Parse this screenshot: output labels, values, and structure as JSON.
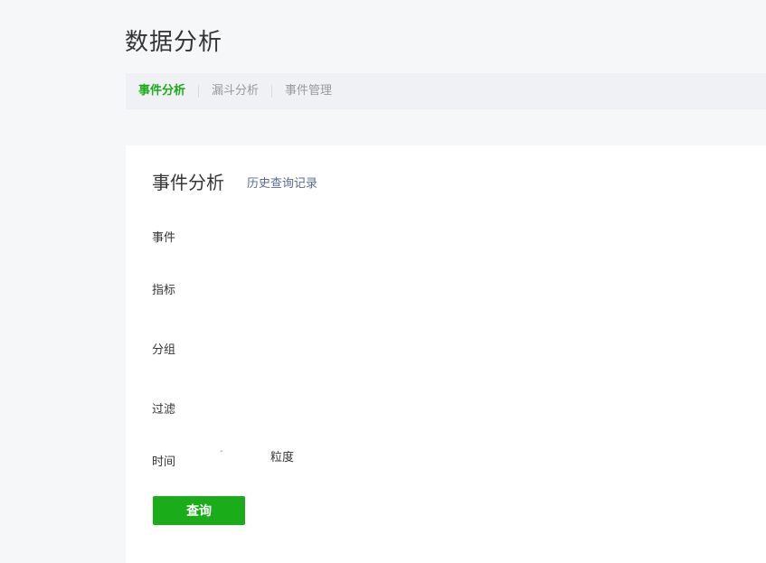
{
  "page": {
    "title": "数据分析"
  },
  "tabs": [
    {
      "label": "事件分析",
      "active": true
    },
    {
      "label": "漏斗分析",
      "active": false
    },
    {
      "label": "事件管理",
      "active": false
    }
  ],
  "card": {
    "title": "事件分析",
    "history_link": "历史查询记录",
    "form": {
      "event_label": "事件",
      "metric_label": "指标",
      "group_label": "分组",
      "filter_label": "过滤",
      "time_label": "时间",
      "time_range_separator": "-",
      "granularity_label": "粒度"
    },
    "query_button": "查询"
  },
  "colors": {
    "accent": "#1aad19",
    "link": "#576b95",
    "background": "#f6f7f9",
    "tabs_bar": "#eff1f4"
  }
}
